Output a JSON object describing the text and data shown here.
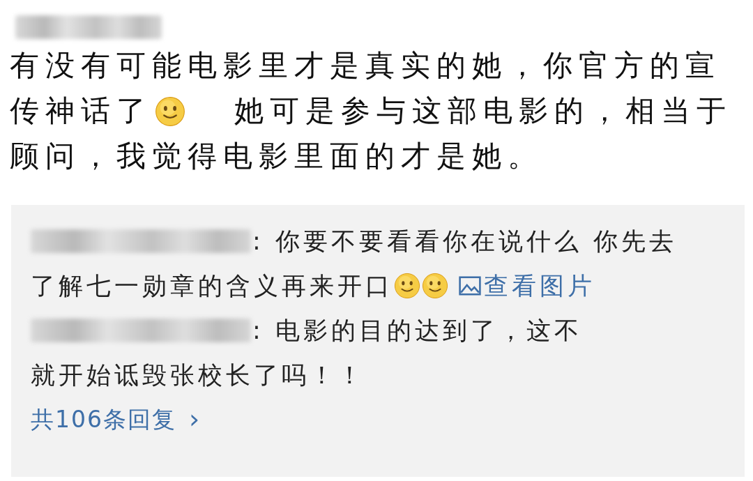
{
  "comment": {
    "author": {
      "redacted": true
    },
    "lines": [
      [
        {
          "kind": "text",
          "text": "有没有可能电影里才是真实的她，你官方的宣"
        }
      ],
      [
        {
          "kind": "text",
          "text": "传神话了"
        },
        {
          "kind": "emoji"
        },
        {
          "kind": "text",
          "text": "她可是参与这部电影的，相当于"
        }
      ],
      [
        {
          "kind": "text",
          "text": "顾问，我觉得电影里面的才是她。"
        }
      ]
    ]
  },
  "replies": [
    {
      "author": {
        "redacted": true
      },
      "lines": [
        [
          {
            "kind": "text",
            "text": ": 你要不要看看你在说什么 你先去"
          }
        ],
        [
          {
            "kind": "text",
            "text": "了解七一勋章的含义再来开口"
          },
          {
            "kind": "emoji"
          },
          {
            "kind": "emoji"
          },
          {
            "kind": "link",
            "text": "查看图片"
          }
        ]
      ]
    },
    {
      "author": {
        "redacted": true
      },
      "lines": [
        [
          {
            "kind": "text",
            "text": ": 电影的目的达到了，这不"
          }
        ],
        [
          {
            "kind": "text",
            "text": "就开始诋毁张校长了吗！！"
          }
        ]
      ]
    }
  ],
  "more_replies": {
    "label": "共106条回复",
    "arrow": "›"
  }
}
